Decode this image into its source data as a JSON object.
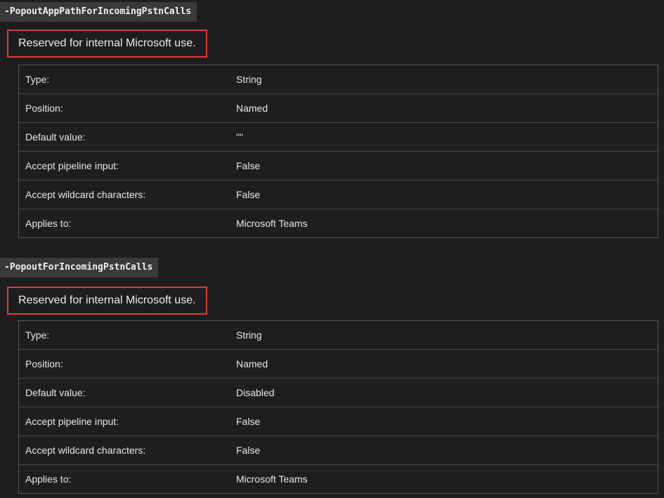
{
  "sections": [
    {
      "param_name": "-PopoutAppPathForIncomingPstnCalls",
      "note": "Reserved for internal Microsoft use.",
      "rows": [
        {
          "key": "Type:",
          "value": "String"
        },
        {
          "key": "Position:",
          "value": "Named"
        },
        {
          "key": "Default value:",
          "value": "\"\""
        },
        {
          "key": "Accept pipeline input:",
          "value": "False"
        },
        {
          "key": "Accept wildcard characters:",
          "value": "False"
        },
        {
          "key": "Applies to:",
          "value": "Microsoft Teams"
        }
      ]
    },
    {
      "param_name": "-PopoutForIncomingPstnCalls",
      "note": "Reserved for internal Microsoft use.",
      "rows": [
        {
          "key": "Type:",
          "value": "String"
        },
        {
          "key": "Position:",
          "value": "Named"
        },
        {
          "key": "Default value:",
          "value": "Disabled"
        },
        {
          "key": "Accept pipeline input:",
          "value": "False"
        },
        {
          "key": "Accept wildcard characters:",
          "value": "False"
        },
        {
          "key": "Applies to:",
          "value": "Microsoft Teams"
        }
      ]
    }
  ],
  "colors": {
    "background": "#1e1e1e",
    "code_background": "#3a3a3a",
    "highlight_border": "#e03b3b",
    "table_border": "#555555"
  }
}
